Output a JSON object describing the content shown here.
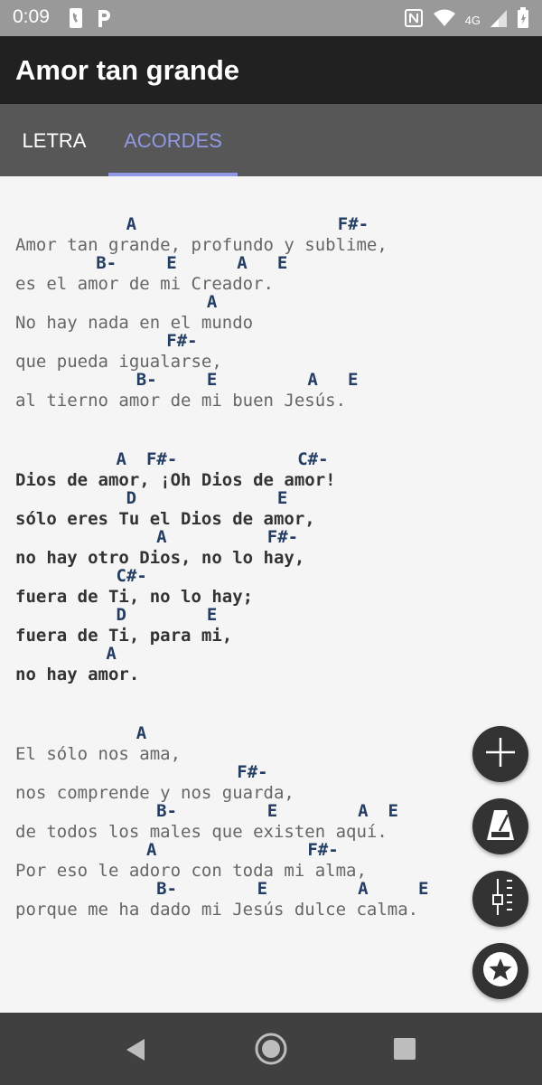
{
  "status_bar": {
    "time": "0:09",
    "network": "4G",
    "icons": [
      "phone-icon",
      "parking-icon",
      "nfc-icon",
      "wifi-icon",
      "signal-icon",
      "battery-icon"
    ]
  },
  "app": {
    "title": "Amor tan grande"
  },
  "tabs": [
    {
      "label": "LETRA",
      "selected": false
    },
    {
      "label": "ACORDES",
      "selected": true
    }
  ],
  "colors": {
    "accent": "#8f99e6",
    "chord": "#243d63",
    "lyric": "#666666",
    "lyric_bold": "#333333",
    "appbar": "#212121",
    "tabbar": "#575757",
    "fab": "#333333",
    "navbar": "#404040"
  },
  "song": {
    "stanzas": [
      {
        "bold": false,
        "lines": [
          {
            "text": "Amor tan grande, profundo y sublime,",
            "chords": [
              {
                "name": "A",
                "col": 11
              },
              {
                "name": "F#-",
                "col": 32
              }
            ]
          },
          {
            "text": "es el amor de mi Creador.",
            "chords": [
              {
                "name": "B-",
                "col": 8
              },
              {
                "name": "E",
                "col": 15
              },
              {
                "name": "A",
                "col": 22
              },
              {
                "name": "E",
                "col": 26
              }
            ]
          },
          {
            "text": "No hay nada en el mundo",
            "chords": [
              {
                "name": "A",
                "col": 19
              }
            ]
          },
          {
            "text": "que pueda igualarse,",
            "chords": [
              {
                "name": "F#-",
                "col": 15
              }
            ]
          },
          {
            "text": "al tierno amor de mi buen Jesús.",
            "chords": [
              {
                "name": "B-",
                "col": 12
              },
              {
                "name": "E",
                "col": 19
              },
              {
                "name": "A",
                "col": 29
              },
              {
                "name": "E",
                "col": 33
              }
            ]
          }
        ]
      },
      {
        "bold": true,
        "lines": [
          {
            "text": "Dios de amor, ¡Oh Dios de amor!",
            "chords": [
              {
                "name": "A",
                "col": 10
              },
              {
                "name": "F#-",
                "col": 13
              },
              {
                "name": "C#-",
                "col": 28
              }
            ]
          },
          {
            "text": "sólo eres Tu el Dios de amor,",
            "chords": [
              {
                "name": "D",
                "col": 11
              },
              {
                "name": "E",
                "col": 26
              }
            ]
          },
          {
            "text": "no hay otro Dios, no lo hay,",
            "chords": [
              {
                "name": "A",
                "col": 14
              },
              {
                "name": "F#-",
                "col": 25
              }
            ]
          },
          {
            "text": "fuera de Ti, no lo hay;",
            "chords": [
              {
                "name": "C#-",
                "col": 10
              }
            ]
          },
          {
            "text": "fuera de Ti, para mi,",
            "chords": [
              {
                "name": "D",
                "col": 10
              },
              {
                "name": "E",
                "col": 19
              }
            ]
          },
          {
            "text": "no hay amor.",
            "chords": [
              {
                "name": "A",
                "col": 9
              }
            ]
          }
        ]
      },
      {
        "bold": false,
        "lines": [
          {
            "text": "El sólo nos ama,",
            "chords": [
              {
                "name": "A",
                "col": 12
              }
            ]
          },
          {
            "text": "nos comprende y nos guarda,",
            "chords": [
              {
                "name": "F#-",
                "col": 22
              }
            ]
          },
          {
            "text": "de todos los males que existen aquí.",
            "chords": [
              {
                "name": "B-",
                "col": 14
              },
              {
                "name": "E",
                "col": 25
              },
              {
                "name": "A",
                "col": 34
              },
              {
                "name": "E",
                "col": 37
              }
            ]
          },
          {
            "text": "Por eso le adoro con toda mi alma,",
            "chords": [
              {
                "name": "A",
                "col": 13
              },
              {
                "name": "F#-",
                "col": 29
              }
            ]
          },
          {
            "text": "porque me ha dado mi Jesús dulce calma.",
            "chords": [
              {
                "name": "B-",
                "col": 14
              },
              {
                "name": "E",
                "col": 24
              },
              {
                "name": "A",
                "col": 34
              },
              {
                "name": "E",
                "col": 40
              }
            ]
          }
        ]
      }
    ]
  },
  "fabs": [
    {
      "name": "add-button",
      "icon": "plus-icon"
    },
    {
      "name": "metronome-button",
      "icon": "metronome-icon"
    },
    {
      "name": "tuner-button",
      "icon": "tuner-icon"
    },
    {
      "name": "favorite-button",
      "icon": "star-icon"
    }
  ],
  "nav_bar": {
    "buttons": [
      "back-icon",
      "home-icon",
      "recents-icon"
    ]
  }
}
